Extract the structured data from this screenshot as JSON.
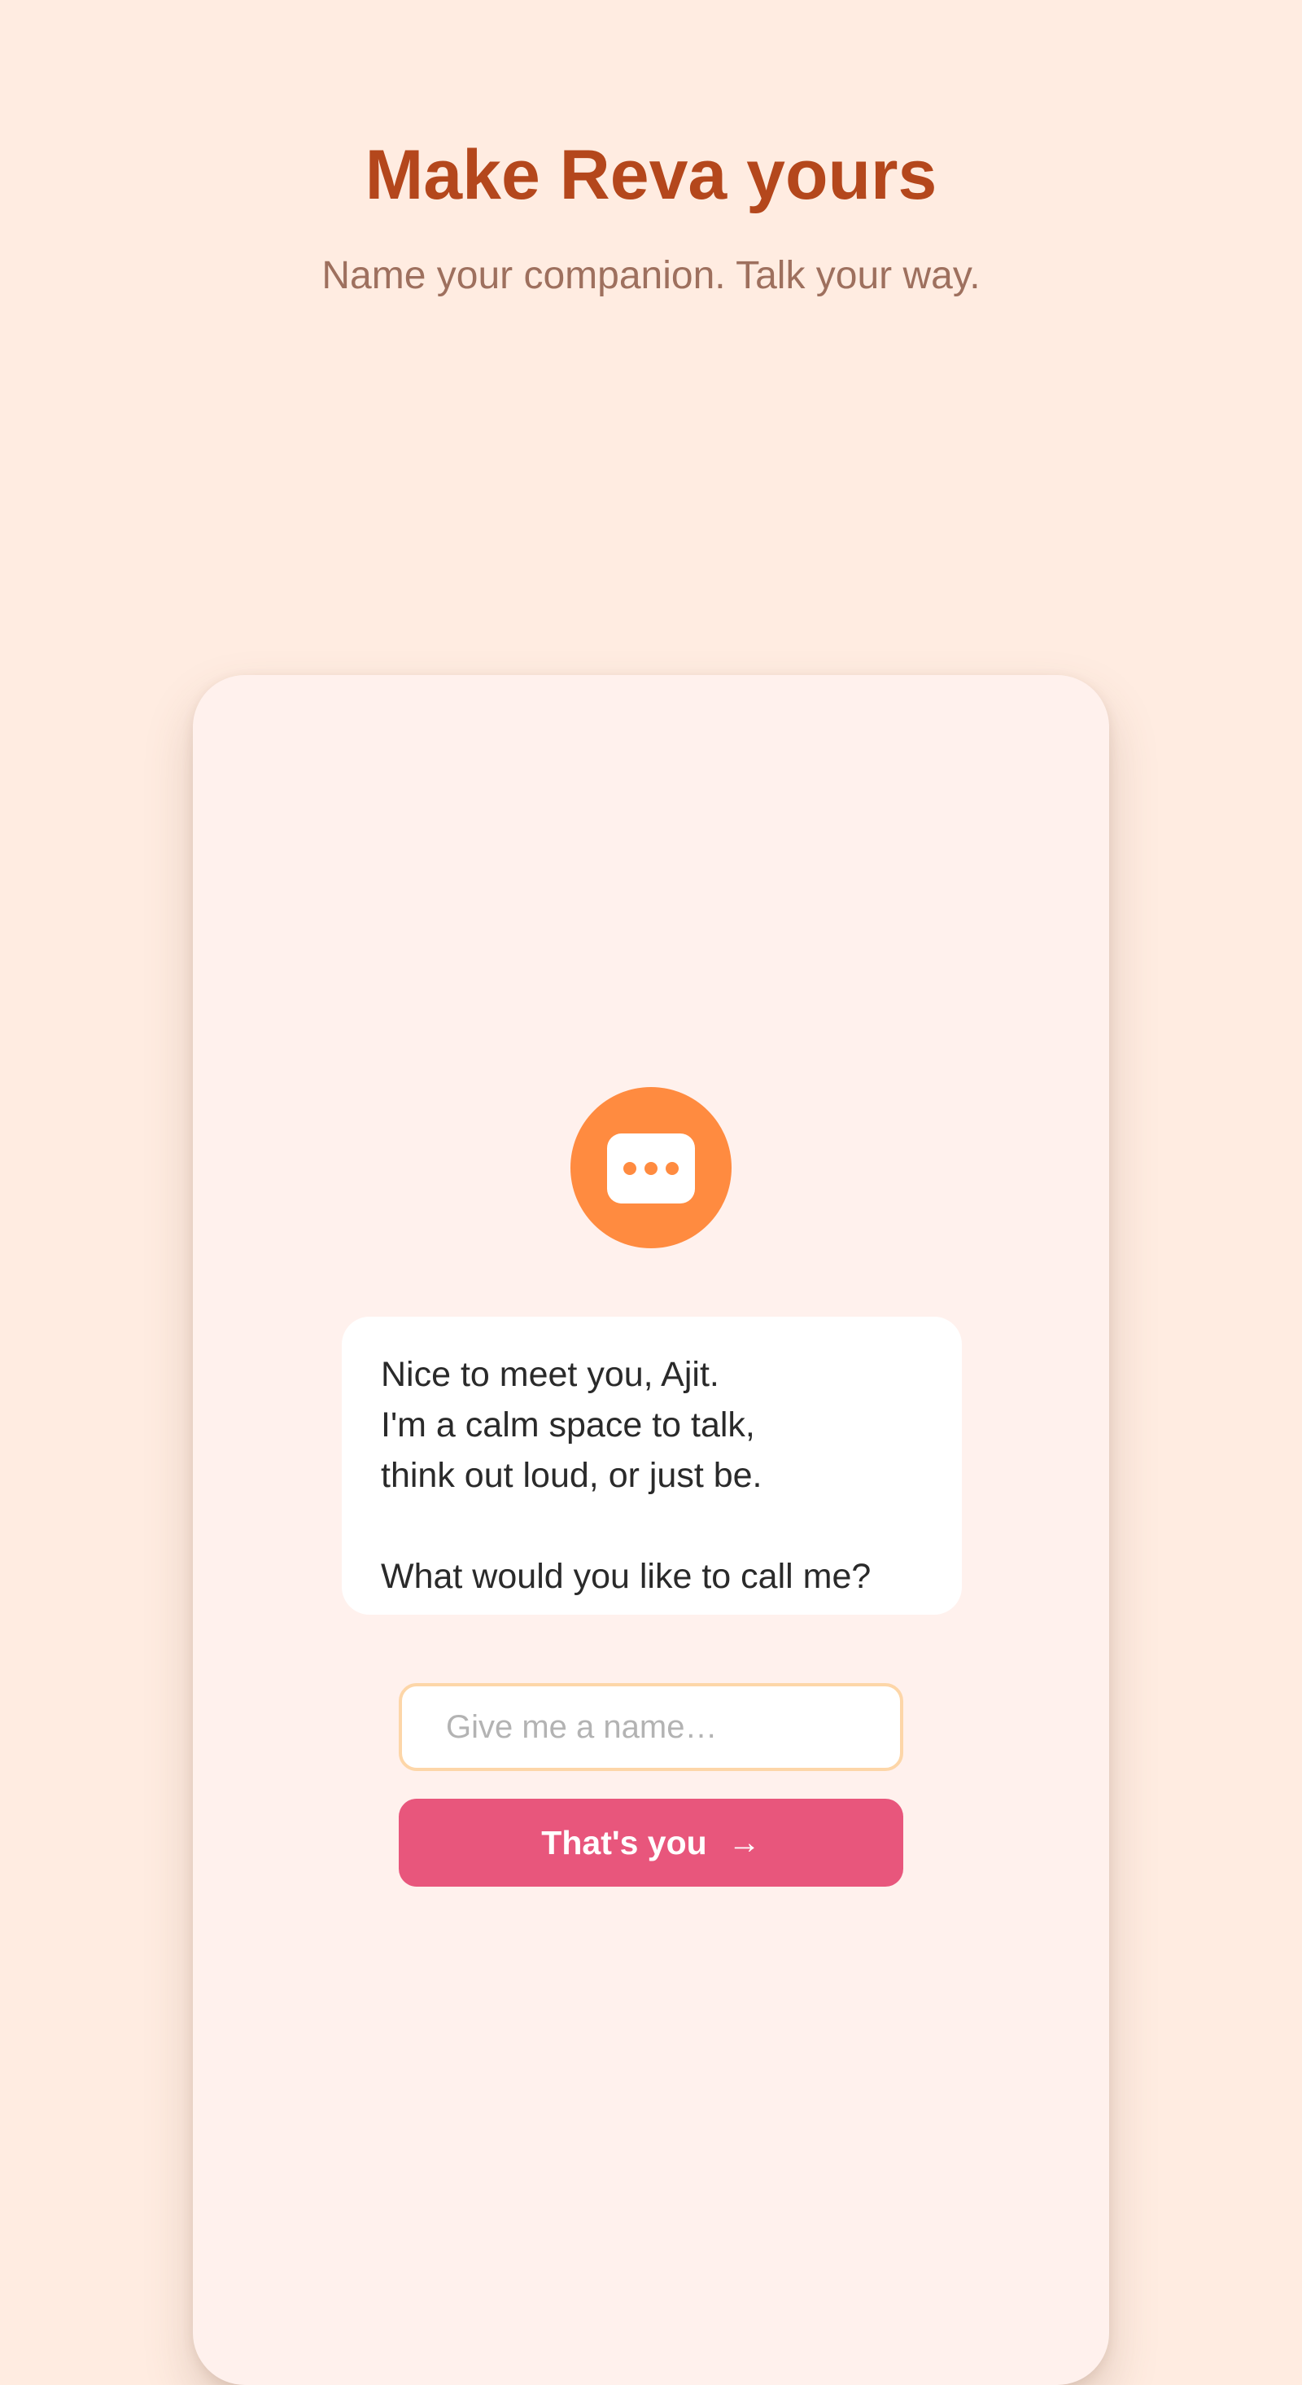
{
  "header": {
    "title": "Make Reva yours",
    "subtitle": "Name your companion. Talk your way."
  },
  "avatar": {
    "icon": "chat-bubble-icon"
  },
  "message": {
    "lines": [
      "Nice to meet you, Ajit.",
      "I'm a calm space to talk,",
      "think out loud, or just be.",
      "",
      "What would you like to call me?"
    ]
  },
  "name_input": {
    "value": "",
    "placeholder": "Give me a name…"
  },
  "submit_button": {
    "label": "That's you",
    "arrow": "→"
  },
  "colors": {
    "background": "#ffece1",
    "title": "#b4471c",
    "subtitle": "#9e705e",
    "card": "#fff1ed",
    "avatar": "#ff8b40",
    "input_border": "#fdd6a8",
    "button": "#e8567c"
  }
}
